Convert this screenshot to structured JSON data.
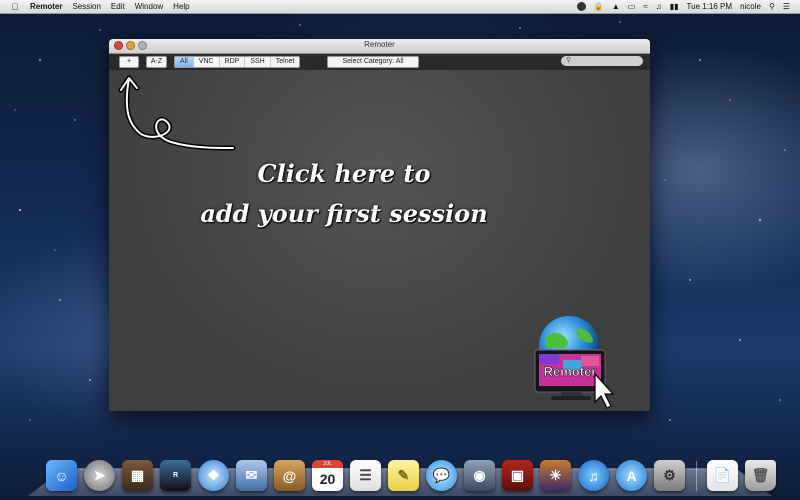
{
  "menubar": {
    "app_name": "Remoter",
    "items": [
      "Session",
      "Edit",
      "Window",
      "Help"
    ],
    "clock": "Tue 1:16 PM",
    "user": "nicole"
  },
  "window": {
    "title": "Remoter",
    "add_label": "+",
    "sort_label": "A-Z",
    "filters": [
      "All",
      "VNC",
      "RDP",
      "SSH",
      "Telnet"
    ],
    "active_filter": "All",
    "category_label": "Select Category: All",
    "search_placeholder": "",
    "hint_line1": "Click here to",
    "hint_line2": "add your first session",
    "logo_text": "Remoter"
  },
  "dock": {
    "calendar_month": "JUL",
    "calendar_day": "20"
  },
  "colors": {
    "accent": "#7fb0e6",
    "window_bg": "#4a4a4a",
    "toolbar_bg": "#2a2a2a"
  }
}
